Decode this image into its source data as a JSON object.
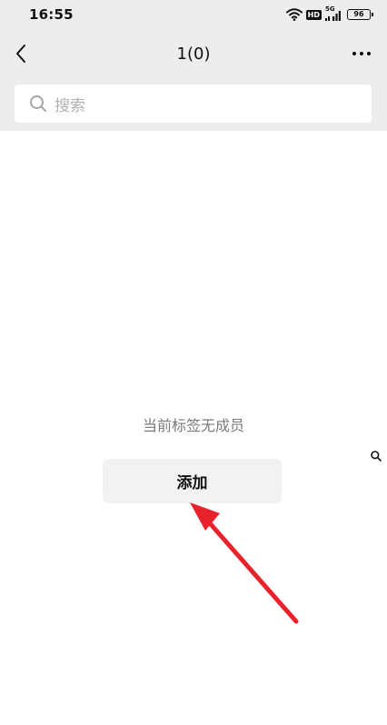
{
  "status_bar": {
    "time": "16:55",
    "network_label": "5G",
    "hd_label": "HD",
    "battery_level": "96"
  },
  "nav": {
    "title": "1(0)",
    "back_icon": "chevron-left-icon",
    "more_icon": "more-horizontal-icon"
  },
  "search": {
    "placeholder": "搜索",
    "icon": "search-icon"
  },
  "empty_state": {
    "message": "当前标签无成员",
    "add_button_label": "添加"
  },
  "annotation": {
    "arrow_color": "#e8222b"
  }
}
